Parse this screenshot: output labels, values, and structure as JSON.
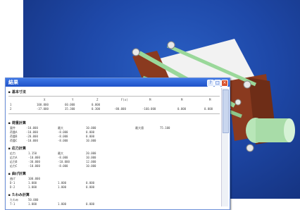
{
  "window": {
    "title": "結果",
    "buttons": {
      "help": "?",
      "maximize": "□",
      "close": "×"
    }
  },
  "sections": {
    "s1_title": "基本寸法",
    "s1_header": [
      "X",
      "Y",
      "Z",
      "F(x)",
      "M",
      "M",
      "M"
    ],
    "s1_rows": [
      [
        "1",
        "100.000",
        "60.000",
        "0.000",
        "",
        "",
        "",
        ""
      ],
      [
        "2",
        "-37.000",
        "35.300",
        "0.300",
        "-80.000",
        "-160.000",
        "0.000",
        "0.000"
      ]
    ],
    "s2_title": "荷重計算",
    "s2_rows": [
      [
        "要件",
        "-10.000",
        "最大",
        "10.000",
        "最大値",
        "75.100"
      ],
      [
        "荷重A",
        "-10.000",
        "-8.000",
        "0.000"
      ],
      [
        "荷重B",
        "-20.000",
        "-8.000",
        "0.000"
      ],
      [
        "荷重C",
        "-10.000",
        "-8.000",
        "10.000"
      ]
    ],
    "s3_title": "応力計算",
    "s3_rows": [
      [
        "応力",
        "1.150",
        "最大",
        "20.000"
      ],
      [
        "応力A",
        "-10.000",
        "-8.000",
        "10.000"
      ],
      [
        "応力B",
        "-30.000",
        "-10.000",
        "12.000"
      ],
      [
        "応力C",
        "-10.000",
        "-8.000",
        "10.000"
      ]
    ],
    "s4_title": "曲げ計算",
    "s4_rows": [
      [
        "曲げ",
        "100.000"
      ],
      [
        "D-1",
        "1.000",
        "1.000",
        "0.000"
      ],
      [
        "D-2",
        "1.000",
        "1.000",
        "0.000"
      ]
    ],
    "s5_title": "たわみ計算",
    "s5_rows": [
      [
        "たわみ",
        "50.000"
      ],
      [
        "T-1",
        "1.000",
        "1.000",
        "0.000"
      ]
    ]
  },
  "colors": {
    "viewport": "#1e48a8",
    "titlebar": "#2a5ed6",
    "flange": "#8a3a1f",
    "rod": "#8fd18f"
  }
}
